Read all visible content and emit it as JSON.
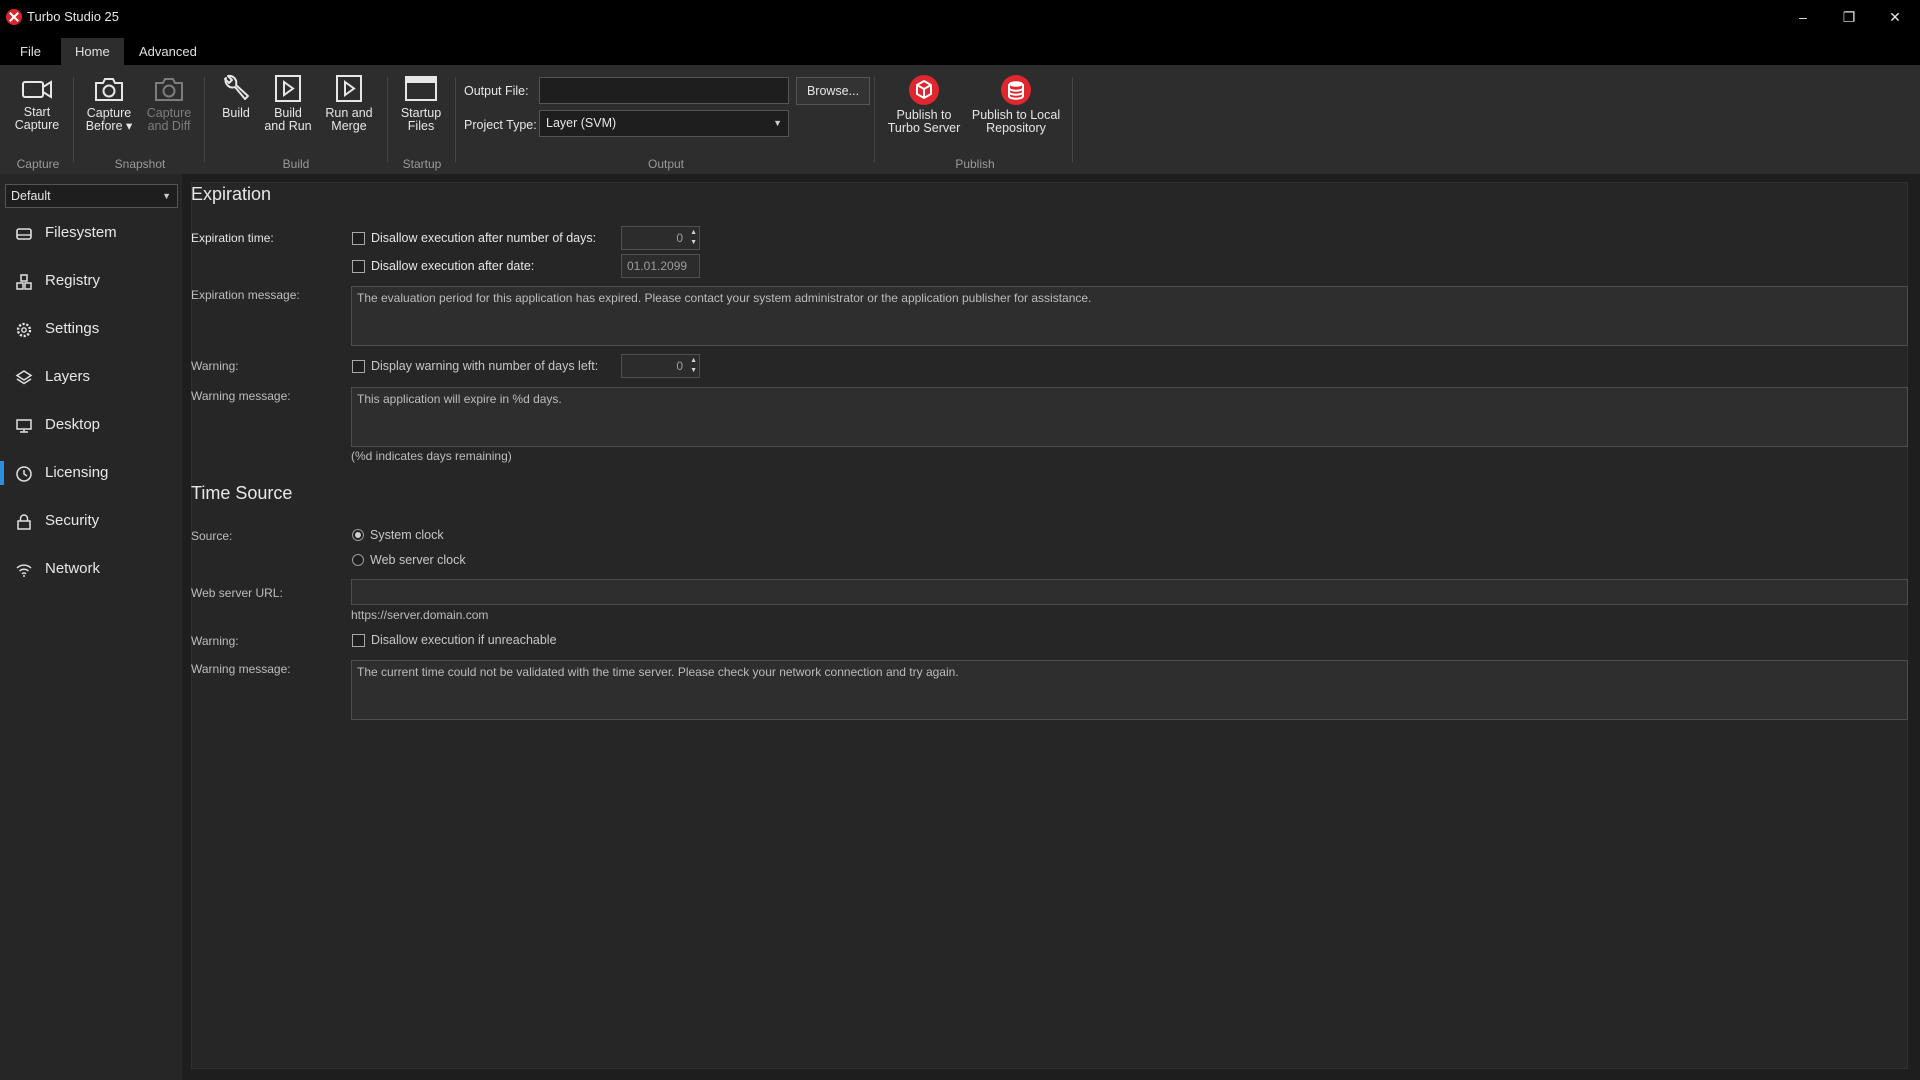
{
  "window": {
    "title": "Turbo Studio 25",
    "minimize": "–",
    "restore": "❐",
    "close": "✕"
  },
  "menu": {
    "tabs": [
      "File",
      "Home",
      "Advanced"
    ],
    "active": "Home"
  },
  "ribbon": {
    "capture": {
      "start_capture": [
        "Start",
        "Capture"
      ],
      "group": "Capture"
    },
    "snapshot": {
      "capture_before": [
        "Capture",
        "Before ▾"
      ],
      "capture_and_diff": [
        "Capture",
        "and Diff"
      ],
      "group": "Snapshot"
    },
    "build": {
      "build": [
        "Build"
      ],
      "build_and_run": [
        "Build",
        "and Run"
      ],
      "run_and_merge": [
        "Run and",
        "Merge"
      ],
      "group": "Build"
    },
    "startup": {
      "startup_files": [
        "Startup",
        "Files"
      ],
      "group": "Startup"
    },
    "output": {
      "output_file_label": "Output File:",
      "output_file_value": "",
      "browse": "Browse...",
      "project_type_label": "Project Type:",
      "project_type_value": "Layer (SVM)",
      "group": "Output"
    },
    "publish": {
      "publish_turbo": [
        "Publish to",
        "Turbo Server"
      ],
      "publish_local": [
        "Publish to Local",
        "Repository"
      ],
      "group": "Publish"
    }
  },
  "sidebar": {
    "profile": "Default",
    "items": [
      {
        "label": "Filesystem",
        "icon": "drive-icon"
      },
      {
        "label": "Registry",
        "icon": "registry-icon"
      },
      {
        "label": "Settings",
        "icon": "gear-icon"
      },
      {
        "label": "Layers",
        "icon": "layers-icon"
      },
      {
        "label": "Desktop",
        "icon": "monitor-icon"
      },
      {
        "label": "Licensing",
        "icon": "clock-icon"
      },
      {
        "label": "Security",
        "icon": "lock-icon"
      },
      {
        "label": "Network",
        "icon": "wifi-icon"
      }
    ],
    "active": "Licensing"
  },
  "expiration": {
    "title": "Expiration",
    "time_label": "Expiration time:",
    "days_checkbox": "Disallow execution after number of days:",
    "days_value": "0",
    "date_checkbox": "Disallow execution after date:",
    "date_value": "01.01.2099",
    "message_label": "Expiration message:",
    "message": "The evaluation period for this application has expired. Please contact your system administrator or the application publisher for assistance.",
    "warning_label": "Warning:",
    "warning_checkbox": "Display warning with number of days left:",
    "warning_days_value": "0",
    "warning_message_label": "Warning message:",
    "warning_message": "This application will expire in %d days.",
    "hint": "(%d indicates days remaining)"
  },
  "time_source": {
    "title": "Time Source",
    "source_label": "Source:",
    "option_system": "System clock",
    "option_web": "Web server clock",
    "selected": "System clock",
    "url_label": "Web server URL:",
    "url_value": "",
    "url_hint": "https://server.domain.com",
    "warning_label": "Warning:",
    "unreachable_checkbox": "Disallow execution if unreachable",
    "warning_message_label": "Warning message:",
    "warning_message": "The current time could not be validated with the time server. Please check your network connection and try again."
  },
  "colors": {
    "accent": "#2d8fe0",
    "publish_red": "#e0262e",
    "background": "#1e1e1e",
    "panel": "#262626"
  }
}
